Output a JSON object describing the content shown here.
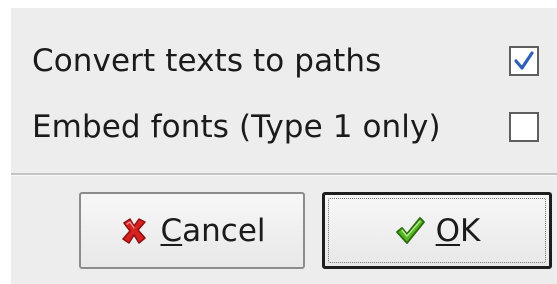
{
  "options": [
    {
      "label": "Convert texts to paths",
      "checked": true
    },
    {
      "label": "Embed fonts (Type 1 only)",
      "checked": false
    }
  ],
  "buttons": {
    "cancel": {
      "mnemonic": "C",
      "rest": "ancel",
      "icon": "red-x-icon"
    },
    "ok": {
      "mnemonic": "O",
      "rest": "K",
      "icon": "green-checkmark-icon"
    }
  },
  "colors": {
    "dialog_bg": "#ededed",
    "check_blue": "#2f5fb8",
    "cancel_red": "#d62121",
    "ok_green": "#56b824"
  }
}
